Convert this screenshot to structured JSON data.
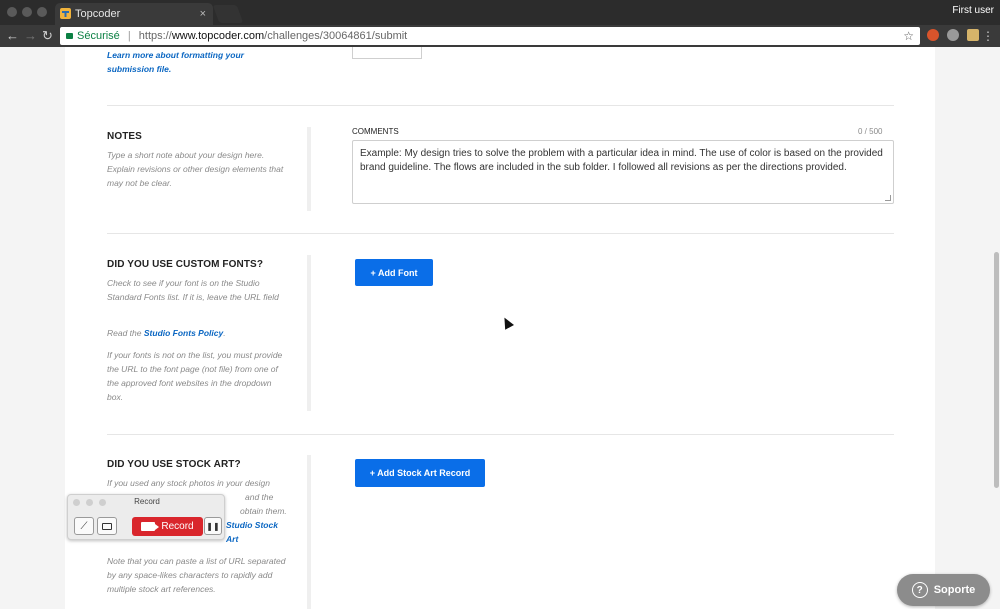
{
  "browser": {
    "tab_title": "Topcoder",
    "tab_close": "×",
    "user_label": "First user",
    "nav": {
      "back": "←",
      "forward": "→",
      "reload": "↻"
    },
    "address": {
      "secure_label": "Sécurisé",
      "separator": "|",
      "scheme": "https://",
      "host": "www.topcoder.com",
      "path": "/challenges/30064861/submit"
    },
    "star_icon": "☆",
    "menu_icon": "⋮"
  },
  "page": {
    "top_link": "Learn more about formatting your submission file.",
    "notes": {
      "title": "NOTES",
      "description": "Type a short note about your design here. Explain revisions or other design elements that may not be clear.",
      "field_label": "COMMENTS",
      "counter": "0 / 500",
      "placeholder": "Example: My design tries to solve the problem with a particular idea in mind. The use of color is based on the provided brand guideline. The flows are included in the sub folder. I followed all revisions as per the directions provided."
    },
    "fonts": {
      "title": "DID YOU USE CUSTOM FONTS?",
      "desc1": "Check to see if your font is on the Studio Standard Fonts list. If it is, leave the URL field",
      "desc2_prefix": "Read the ",
      "desc2_link": "Studio Fonts Policy",
      "desc2_suffix": ".",
      "desc3": "If your fonts is not on the list, you must provide the URL to the font page (not file) from one of the approved font websites in the dropdown box.",
      "button": "+ Add Font"
    },
    "stock": {
      "title": "DID YOU USE STOCK ART?",
      "desc1": "If you used any stock photos in your design",
      "desc1_b": "and the",
      "desc1_c": "obtain them.",
      "desc_link": "Studio Stock Art",
      "desc2": "Note that you can paste a list of URL separated by any space-likes characters to rapidly add multiple stock art references.",
      "button": "+ Add Stock Art Record"
    }
  },
  "recorder": {
    "title": "Record",
    "record_label": "Record",
    "pause_icon": "❚❚",
    "pen_icon": "⟋"
  },
  "support": {
    "label": "Soporte",
    "icon": "?"
  }
}
